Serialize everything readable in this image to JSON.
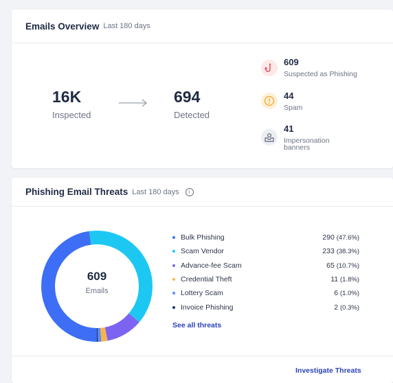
{
  "overview": {
    "title": "Emails Overview",
    "period": "Last 180 days",
    "inspected_value": "16K",
    "inspected_label": "Inspected",
    "detected_value": "694",
    "detected_label": "Detected",
    "stats": [
      {
        "value": "609",
        "label": "Suspected as Phishing",
        "icon": "fishing-hook-icon",
        "color": "#e5484d"
      },
      {
        "value": "44",
        "label": "Spam",
        "icon": "exclamation-icon",
        "color": "#f5a623"
      },
      {
        "value": "41",
        "label_line1": "Impersonation",
        "label_line2": "banners",
        "icon": "inbox-person-icon",
        "color": "#5b6275"
      }
    ]
  },
  "threats": {
    "title": "Phishing Email Threats",
    "period": "Last 180 days",
    "center_value": "609",
    "center_label": "Emails",
    "legend": [
      {
        "name": "Bulk Phishing",
        "count": "290",
        "pct": "(47.6%)",
        "color": "#3d6ef5"
      },
      {
        "name": "Scam Vendor",
        "count": "233",
        "pct": "(38.3%)",
        "color": "#1cc8f2"
      },
      {
        "name": "Advance-fee Scam",
        "count": "65",
        "pct": "(10.7%)",
        "color": "#7d63f2"
      },
      {
        "name": "Credential Theft",
        "count": "11",
        "pct": "(1.8%)",
        "color": "#f7b44b"
      },
      {
        "name": "Lottery Scam",
        "count": "6",
        "pct": "(1.0%)",
        "color": "#5b8cf5"
      },
      {
        "name": "Invoice Phishing",
        "count": "2",
        "pct": "(0.3%)",
        "color": "#1e2f6e"
      }
    ],
    "see_all": "See all threats",
    "investigate": "Investigate Threats"
  },
  "chart_data": {
    "type": "pie",
    "categories": [
      "Bulk Phishing",
      "Scam Vendor",
      "Advance-fee Scam",
      "Credential Theft",
      "Lottery Scam",
      "Invoice Phishing"
    ],
    "values": [
      290,
      233,
      65,
      11,
      6,
      2
    ],
    "title": "Phishing Email Threats"
  }
}
